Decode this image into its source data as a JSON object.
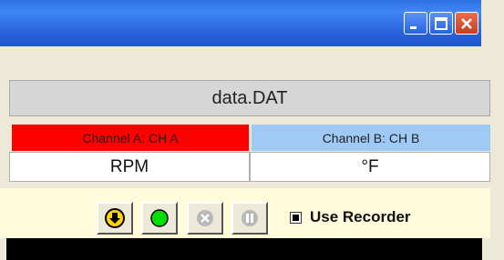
{
  "window": {
    "minimize_icon": "minimize-icon",
    "maximize_icon": "maximize-icon",
    "close_icon": "close-icon"
  },
  "file": {
    "name": "data.DAT"
  },
  "channels": {
    "a": {
      "label": "Channel A: CH A",
      "unit": "RPM",
      "color": "#ff0000"
    },
    "b": {
      "label": "Channel B: CH B",
      "unit": "°F",
      "color": "#9fcaf5"
    }
  },
  "toolbar": {
    "buttons": [
      "download-icon",
      "record-icon",
      "stop-icon",
      "pause-icon"
    ],
    "use_recorder_label": "Use Recorder",
    "use_recorder_checked": true
  }
}
